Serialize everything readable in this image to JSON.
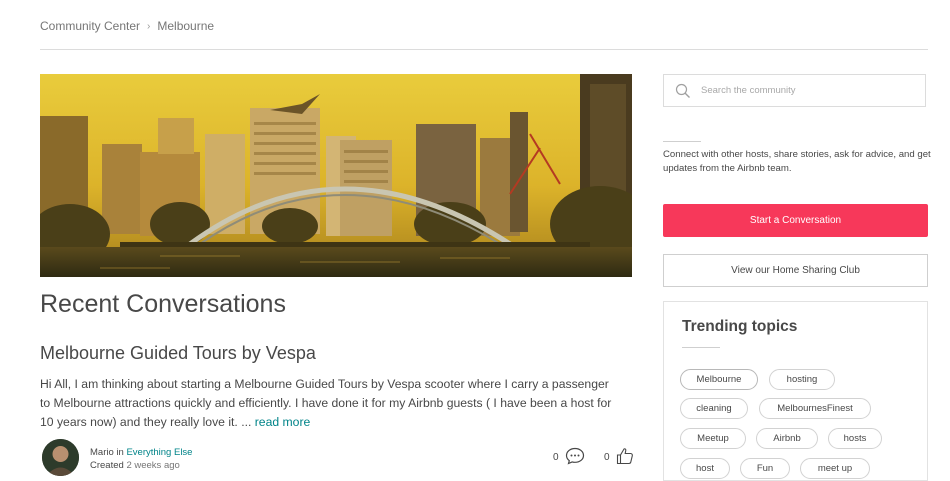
{
  "breadcrumb": {
    "items": [
      "Community Center",
      "Melbourne"
    ],
    "separator": "›"
  },
  "main": {
    "section_title": "Recent Conversations",
    "post": {
      "title": "Melbourne Guided Tours by Vespa",
      "excerpt": "Hi All, I am thinking about starting a Melbourne Guided Tours by Vespa scooter where I carry a passenger to Melbourne attractions quickly and efficiently. I have done it for my Airbnb guests ( I have been a host for 10 years now) and they really love it. ...",
      "read_more": "read more",
      "author": "Mario",
      "in_word": "in",
      "category": "Everything Else",
      "created_label": "Created",
      "created_time": "2 weeks ago",
      "comments_count": "0",
      "likes_count": "0"
    }
  },
  "sidebar": {
    "search_placeholder": "Search the community",
    "connect_text": "Connect with other hosts, share stories, ask for advice, and get updates from the Airbnb team.",
    "start_button": "Start a Conversation",
    "club_button": "View our Home Sharing Club",
    "trending": {
      "title": "Trending topics",
      "tags": [
        "Melbourne",
        "hosting",
        "cleaning",
        "MelbournesFinest",
        "Meetup",
        "Airbnb",
        "hosts",
        "host",
        "Fun",
        "meet up"
      ]
    }
  },
  "colors": {
    "accent": "#f7385a",
    "link": "#008489",
    "text": "#484848",
    "muted": "#767676"
  },
  "icons": {
    "search": "search-icon",
    "comment": "comment-icon",
    "like": "thumbs-up-icon",
    "breadcrumb_sep": "chevron-right-icon"
  }
}
